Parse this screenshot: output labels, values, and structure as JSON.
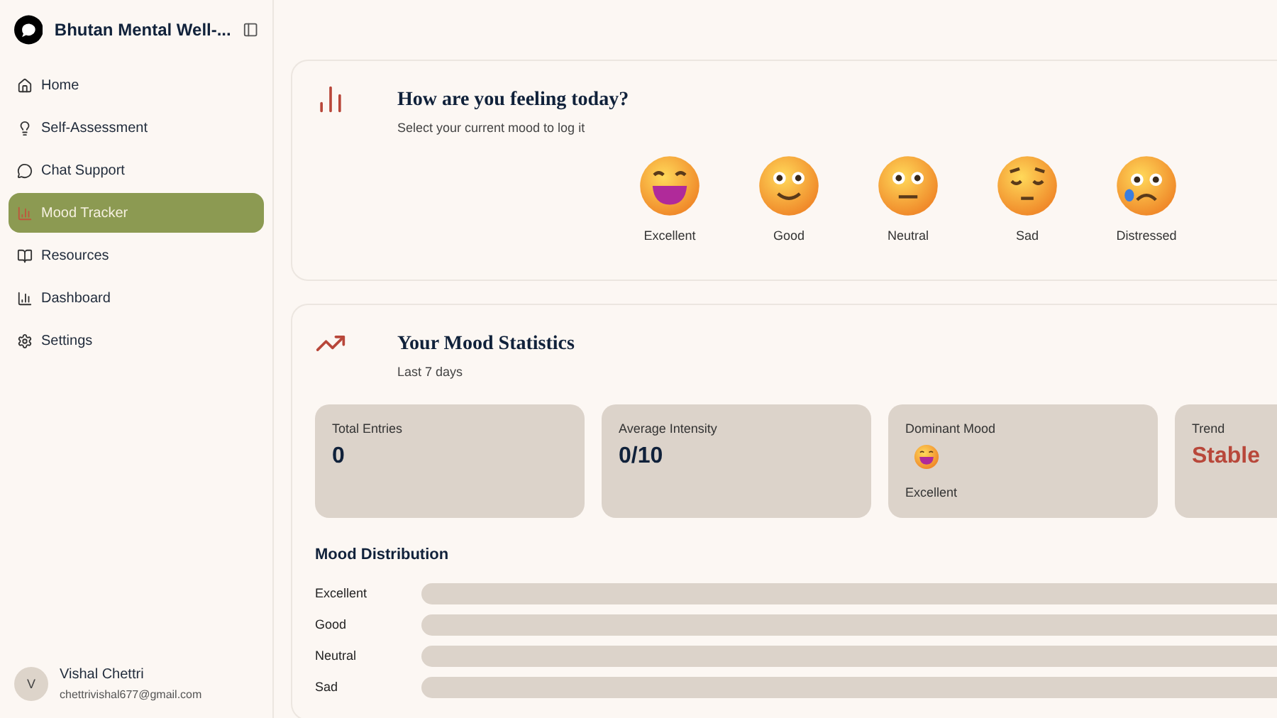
{
  "sidebar": {
    "title": "Bhutan Mental Well-...",
    "items": [
      {
        "label": "Home",
        "selected": false
      },
      {
        "label": "Self-Assessment",
        "selected": false
      },
      {
        "label": "Chat Support",
        "selected": false
      },
      {
        "label": "Mood Tracker",
        "selected": true
      },
      {
        "label": "Resources",
        "selected": false
      },
      {
        "label": "Dashboard",
        "selected": false
      },
      {
        "label": "Settings",
        "selected": false
      }
    ],
    "user": {
      "initial": "V",
      "name": "Vishal Chettri",
      "email": "chettrivishal677@gmail.com"
    }
  },
  "mood_card": {
    "title": "How are you feeling today?",
    "subtitle": "Select your current mood to log it",
    "moods": [
      {
        "kind": "excellent",
        "label": "Excellent"
      },
      {
        "kind": "good",
        "label": "Good"
      },
      {
        "kind": "neutral",
        "label": "Neutral"
      },
      {
        "kind": "sad",
        "label": "Sad"
      },
      {
        "kind": "distressed",
        "label": "Distressed"
      }
    ]
  },
  "stats_card": {
    "title": "Your Mood Statistics",
    "subtitle": "Last 7 days",
    "stats": [
      {
        "kind": "value",
        "label": "Total Entries",
        "value": "0"
      },
      {
        "kind": "value",
        "label": "Average Intensity",
        "value": "0/10"
      },
      {
        "kind": "mood",
        "label": "Dominant Mood",
        "value": "Excellent"
      },
      {
        "kind": "trend",
        "label": "Trend",
        "value": "Stable"
      }
    ],
    "distribution_title": "Mood Distribution",
    "distribution": [
      {
        "label": "Excellent",
        "level": 0
      },
      {
        "label": "Good",
        "level": 0
      },
      {
        "label": "Neutral",
        "level": 0
      },
      {
        "label": "Sad",
        "level": 0
      }
    ]
  }
}
